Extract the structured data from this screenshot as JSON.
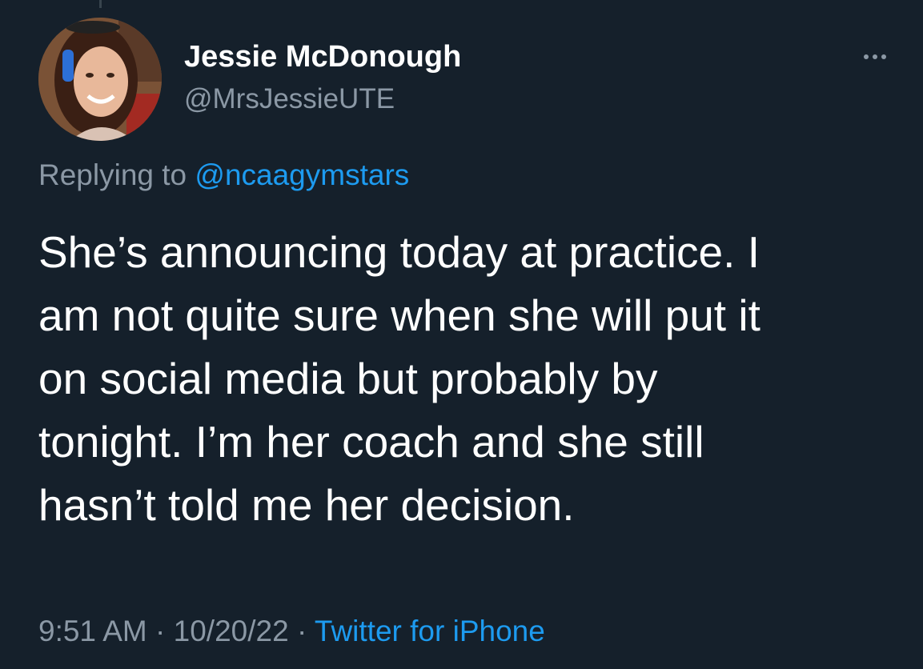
{
  "tweet": {
    "author": {
      "display_name": "Jessie McDonough",
      "handle": "@MrsJessieUTE",
      "avatar_icon": "profile-photo"
    },
    "more_icon": "ellipsis-icon",
    "reply": {
      "prefix": "Replying to ",
      "mention": "@ncaagymstars"
    },
    "text": "She’s announcing today at practice. I\nam not quite sure when she will put it\non social media but probably by\ntonight. I’m her coach and she still\nhasn’t told me her decision.",
    "time": "9:51 AM",
    "separator": " · ",
    "date": "10/20/22",
    "source": "Twitter for iPhone"
  },
  "colors": {
    "background": "#15202b",
    "primary_text": "#ffffff",
    "secondary_text": "#8b98a5",
    "accent": "#1d9bf0"
  }
}
